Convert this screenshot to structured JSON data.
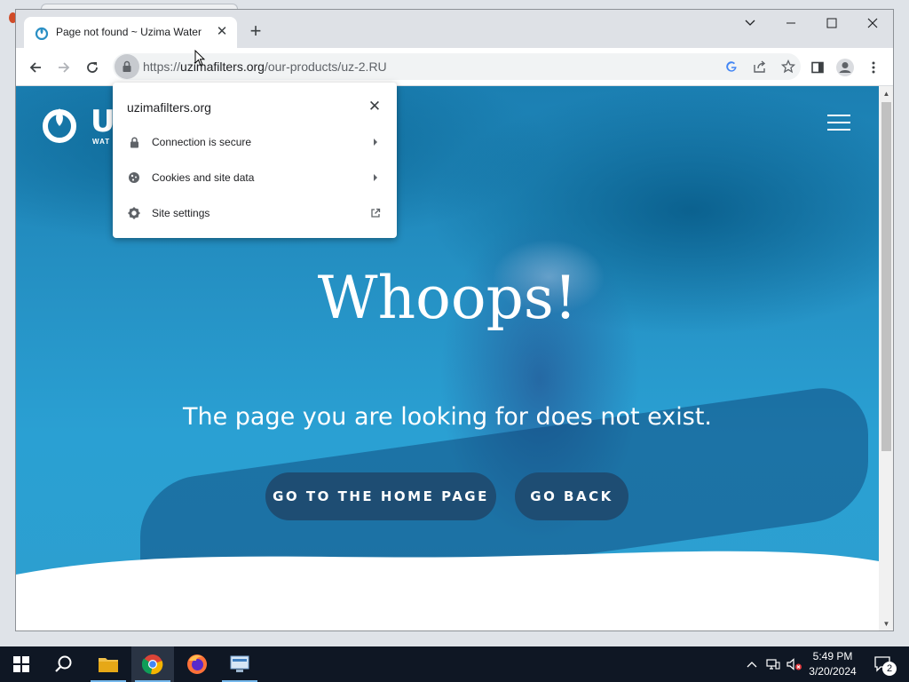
{
  "browser": {
    "tab": {
      "title": "Page not found ~ Uzima Water F"
    },
    "address": {
      "scheme": "https://",
      "domain": "uzimafilters.org",
      "path": "/our-products/uz-2.RU"
    }
  },
  "site_info_popup": {
    "domain": "uzimafilters.org",
    "items": [
      {
        "label": "Connection is secure",
        "icon": "lock-icon"
      },
      {
        "label": "Cookies and site data",
        "icon": "cookie-icon"
      },
      {
        "label": "Site settings",
        "icon": "gear-icon"
      }
    ]
  },
  "page": {
    "logo_text": "U",
    "logo_sub": "WAT",
    "headline": "Whoops!",
    "message": "The page you are looking for does not exist.",
    "buttons": {
      "home": "GO TO THE HOME PAGE",
      "back": "GO BACK"
    },
    "colors": {
      "hero_blue": "#2a9bd0",
      "button_bg": "#1e4d73"
    }
  },
  "taskbar": {
    "time": "5:49 PM",
    "date": "3/20/2024",
    "notification_count": "2"
  }
}
